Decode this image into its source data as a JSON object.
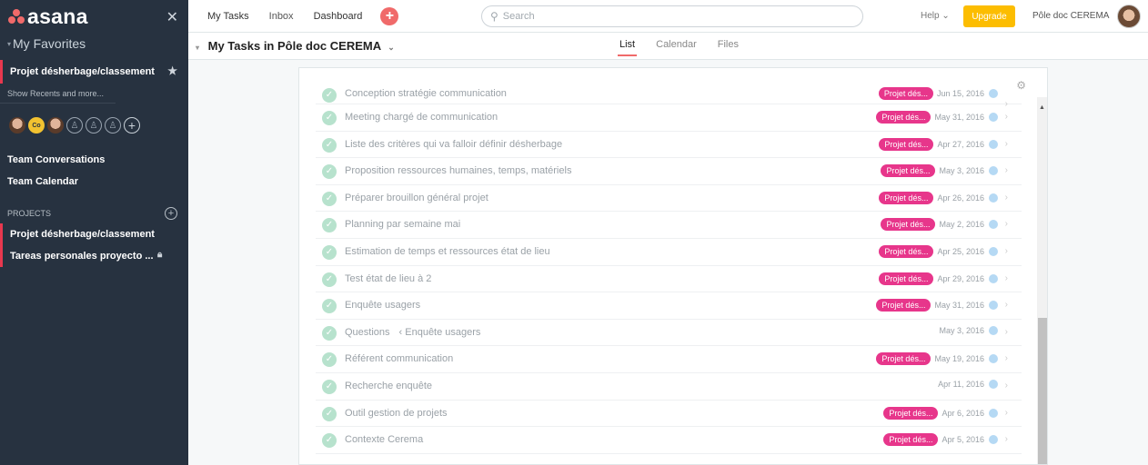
{
  "sidebar": {
    "logo": "asana",
    "close_icon": "✕",
    "favorites_label": "My Favorites",
    "favorite_item": "Projet désherbage/classement",
    "show_recents": "Show Recents and more...",
    "avatar_co": "Co",
    "nav": [
      "Team Conversations",
      "Team Calendar"
    ],
    "projects_label": "PROJECTS",
    "projects": [
      "Projet désherbage/classement",
      "Tareas personales proyecto ..."
    ]
  },
  "topbar": {
    "nav": [
      "My Tasks",
      "Inbox",
      "Dashboard"
    ],
    "plus": "+",
    "search_placeholder": "Search",
    "help": "Help",
    "upgrade": "Upgrade",
    "org": "Pôle doc CEREMA"
  },
  "header": {
    "title": "My Tasks in Pôle doc CEREMA",
    "tabs": [
      "List",
      "Calendar",
      "Files"
    ],
    "active_tab": "List"
  },
  "tasks": [
    {
      "name": "Conception stratégie communication",
      "tag": "Projet dés...",
      "date": "Jun 15, 2016"
    },
    {
      "name": "Meeting chargé de communication",
      "tag": "Projet dés...",
      "date": "May 31, 2016"
    },
    {
      "name": "Liste des critères qui va falloir définir désherbage",
      "tag": "Projet dés...",
      "date": "Apr 27, 2016"
    },
    {
      "name": "Proposition ressources humaines, temps, matériels",
      "tag": "Projet dés...",
      "date": "May 3, 2016"
    },
    {
      "name": "Préparer brouillon général projet",
      "tag": "Projet dés...",
      "date": "Apr 26, 2016"
    },
    {
      "name": "Planning par semaine mai",
      "tag": "Projet dés...",
      "date": "May 2, 2016"
    },
    {
      "name": "Estimation de temps et ressources état de lieu",
      "tag": "Projet dés...",
      "date": "Apr 25, 2016"
    },
    {
      "name": "Test état de lieu à 2",
      "tag": "Projet dés...",
      "date": "Apr 29, 2016"
    },
    {
      "name": "Enquête usagers",
      "tag": "Projet dés...",
      "date": "May 31, 2016"
    },
    {
      "name": "Questions",
      "parent": "‹ Enquête usagers",
      "tag": "",
      "date": "May 3, 2016"
    },
    {
      "name": "Référent communication",
      "tag": "Projet dés...",
      "date": "May 19, 2016"
    },
    {
      "name": "Recherche enquête",
      "tag": "",
      "date": "Apr 11, 2016"
    },
    {
      "name": "Outil gestion de projets",
      "tag": "Projet dés...",
      "date": "Apr 6, 2016"
    },
    {
      "name": "Contexte Cerema",
      "tag": "Projet dés...",
      "date": "Apr 5, 2016"
    }
  ],
  "colors": {
    "sidebar_bg": "#273240",
    "accent": "#f06a6a",
    "tag": "#e7368b",
    "upgrade": "#fcbd01"
  }
}
